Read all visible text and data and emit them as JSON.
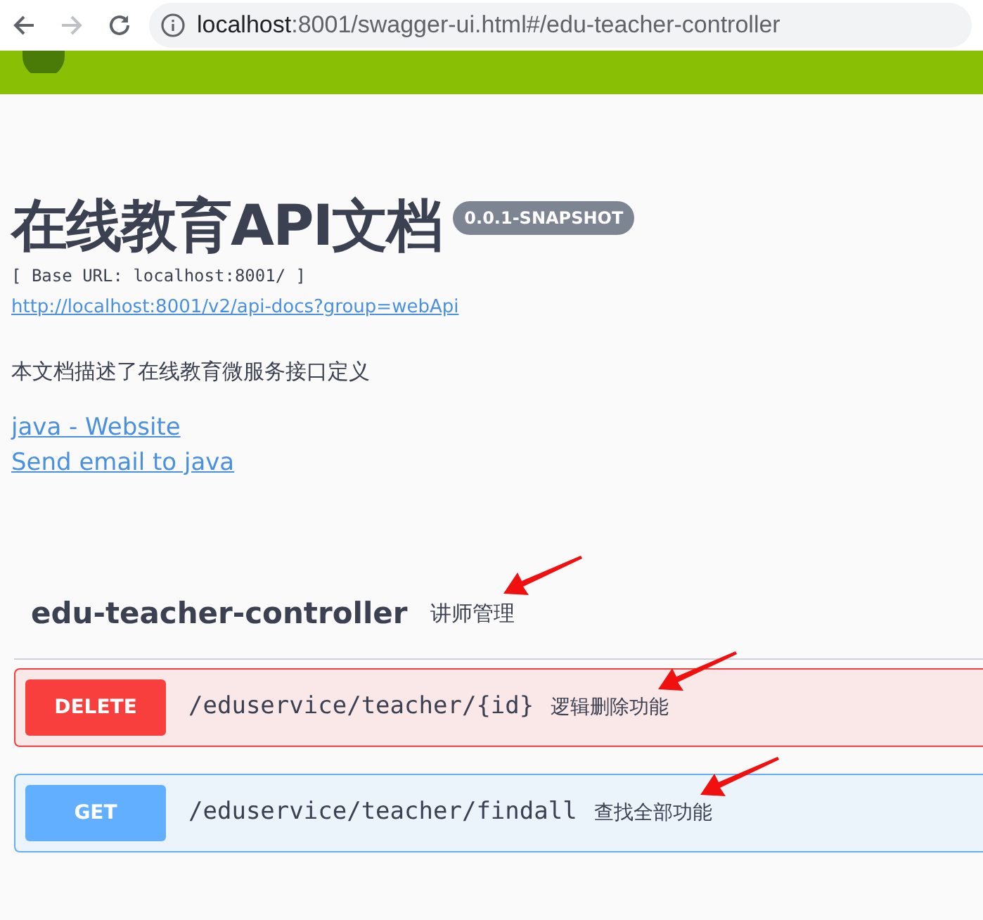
{
  "browser": {
    "url_host": "localhost",
    "url_rest": ":8001/swagger-ui.html#/edu-teacher-controller"
  },
  "info": {
    "title": "在线教育API文档",
    "version": "0.0.1-SNAPSHOT",
    "base_url": "[ Base URL: localhost:8001/ ]",
    "docs_link": "http://localhost:8001/v2/api-docs?group=webApi",
    "description": "本文档描述了在线教育微服务接口定义",
    "links": [
      "java - Website",
      "Send email to java"
    ]
  },
  "tag": {
    "name": "edu-teacher-controller",
    "description": "讲师管理",
    "arrow": true
  },
  "operations": [
    {
      "method": "DELETE",
      "path": "/eduservice/teacher/{id}",
      "summary": "逻辑删除功能",
      "arrow": true
    },
    {
      "method": "GET",
      "path": "/eduservice/teacher/findall",
      "summary": "查找全部功能",
      "arrow": true
    }
  ]
}
